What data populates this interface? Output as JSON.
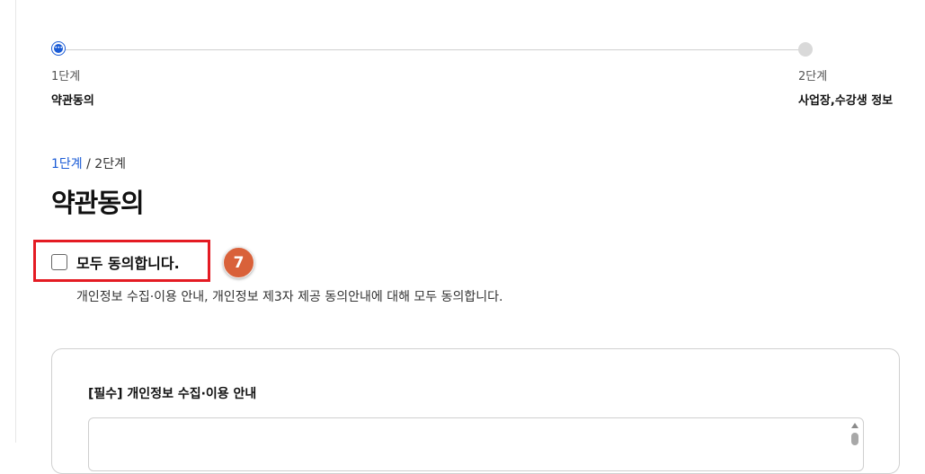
{
  "stepper": {
    "steps": [
      {
        "num": "1단계",
        "name": "약관동의",
        "status": "active"
      },
      {
        "num": "2단계",
        "name": "사업장,수강생 정보",
        "status": "inactive"
      }
    ],
    "active_dot_glyph": "•••"
  },
  "breadcrumb": {
    "current": "1단계",
    "separator": " / ",
    "total": "2단계"
  },
  "page_title": "약관동의",
  "agree_all": {
    "label": "모두 동의합니다.",
    "checked": false,
    "description": "개인정보 수집·이용 안내, 개인정보 제3자 제공 동의안내에 대해 모두 동의합니다.",
    "annotation_number": "7",
    "highlight_color": "#e41b23",
    "annotation_color": "#d9613a"
  },
  "terms_card": {
    "title": "[필수] 개인정보 수집·이용 안내",
    "content": ""
  },
  "colors": {
    "accent": "#1a5bd6"
  }
}
